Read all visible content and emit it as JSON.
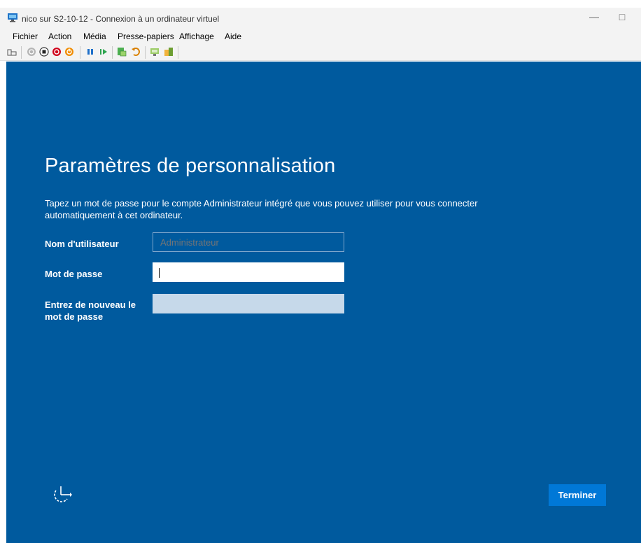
{
  "window": {
    "title": "nico sur S2-10-12 - Connexion à un ordinateur virtuel",
    "minimize": "—",
    "maximize": "□"
  },
  "menu": [
    "Fichier",
    "Action",
    "Média",
    "Presse-papiers",
    "Affichage",
    "Aide"
  ],
  "toolbar": {
    "icons": [
      "ctrl-alt-del-icon",
      "start-icon",
      "turn-off-icon",
      "shut-down-icon",
      "save-state-icon",
      "pause-icon",
      "resume-icon",
      "checkpoint-icon",
      "revert-icon",
      "enhanced-session-icon",
      "share-icon"
    ]
  },
  "setup": {
    "heading": "Paramètres de personnalisation",
    "description": "Tapez un mot de passe pour le compte Administrateur intégré que vous pouvez utiliser pour vous connecter automatiquement à cet ordinateur.",
    "username_label": "Nom d'utilisateur",
    "username_value": "Administrateur",
    "password_label": "Mot de passe",
    "password_value": "",
    "confirm_label_1": "Entrez de nouveau le",
    "confirm_label_2": "mot de passe",
    "confirm_value": "",
    "finish_button": "Terminer"
  },
  "colors": {
    "screen_bg": "#005a9e",
    "button_bg": "#0078d7",
    "chrome_bg": "#f3f3f3"
  }
}
